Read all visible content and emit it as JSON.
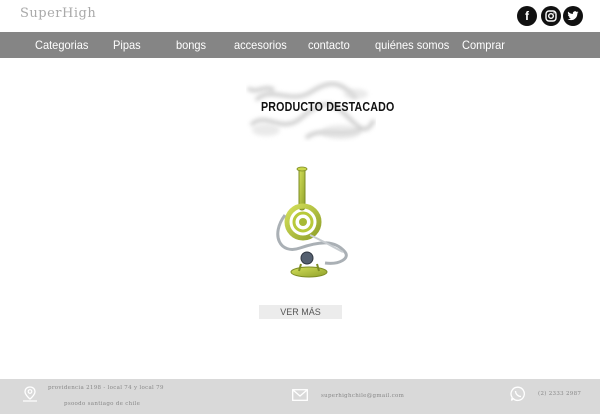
{
  "header": {
    "logo": "SuperHigh",
    "social": [
      {
        "name": "facebook",
        "glyph": "f"
      },
      {
        "name": "instagram",
        "glyph": "◎"
      },
      {
        "name": "twitter",
        "glyph": "✓"
      }
    ]
  },
  "nav": {
    "items": [
      "Categorias",
      "Pipas",
      "bongs",
      "accesorios",
      "contacto",
      "quiénes somos",
      "Comprar"
    ]
  },
  "main": {
    "featured_title": "PRODUCTO DESTACADO",
    "more_button": "VER MÁS"
  },
  "footer": {
    "address_line1": "providencia 2198 - local 74 y local 79",
    "address_line2": "psoodo santiago de chile",
    "email": "superhighchile@gmail.com",
    "phone": "(2) 2333 2987"
  },
  "colors": {
    "nav_bg": "#858585",
    "footer_bg": "#d9d9d9",
    "button_bg": "#ececec",
    "product_glass": "#b8c93a"
  }
}
